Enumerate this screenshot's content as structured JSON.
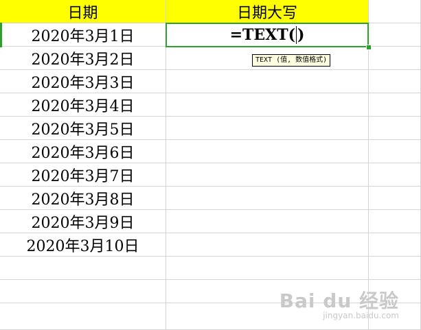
{
  "headers": {
    "date": "日期",
    "date_upper": "日期大写"
  },
  "dates": [
    "2020年3月1日",
    "2020年3月2日",
    "2020年3月3日",
    "2020年3月4日",
    "2020年3月5日",
    "2020年3月6日",
    "2020年3月7日",
    "2020年3月8日",
    "2020年3月9日",
    "2020年3月10日"
  ],
  "active_cell": {
    "before_cursor": "=TEXT(",
    "after_cursor": ")"
  },
  "tooltip": "TEXT (值, 数值格式)",
  "watermark": {
    "brand": "Bai du 经验",
    "url": "jingyan.baidu.com"
  },
  "colors": {
    "header_fill": "#ffff00",
    "selection": "#2e9e2e",
    "gridline": "#d4d4d4",
    "tooltip_bg": "#ffffe1"
  }
}
